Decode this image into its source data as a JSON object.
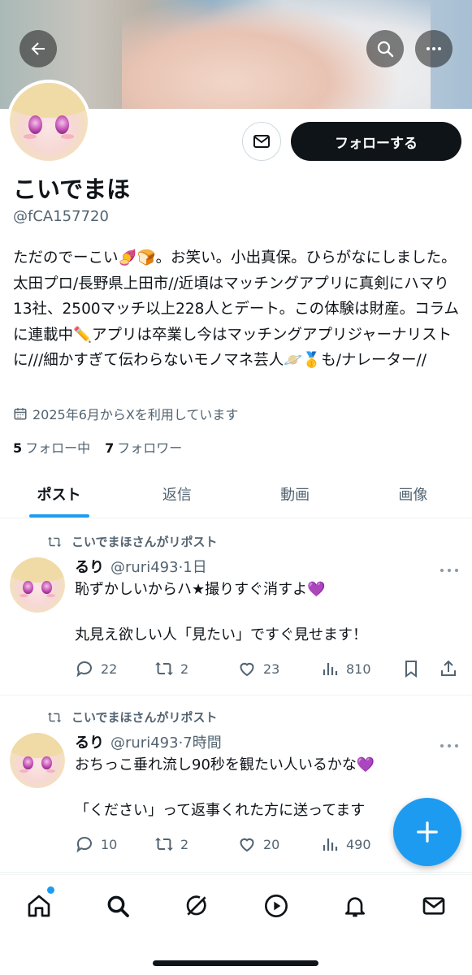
{
  "profile": {
    "name": "こいでまほ",
    "handle": "@fCA157720",
    "bio": "ただのでーこい🍠🍞。お笑い。小出真保。ひらがなにしました。太田プロ/長野県上田市//近頃はマッチングアプリに真剣にハマり13社、2500マッチ以上228人とデート。この体験は財産。コラムに連載中✏️アプリは卒業し今はマッチングアプリジャーナリストに///細かすぎて伝わらないモノマネ芸人🪐🥇も/ナレーター//",
    "joined": "2025年6月からXを利用しています",
    "following_count": "5",
    "following_label": "フォロー中",
    "followers_count": "7",
    "followers_label": "フォロワー",
    "follow_button": "フォローする"
  },
  "tabs": [
    {
      "label": "ポスト",
      "active": true
    },
    {
      "label": "返信",
      "active": false
    },
    {
      "label": "動画",
      "active": false
    },
    {
      "label": "画像",
      "active": false
    }
  ],
  "posts": [
    {
      "repost_label": "こいでまほさんがリポスト",
      "author": "るり",
      "meta": "@ruri493·1日",
      "text": "恥ずかしいからハ★撮りすぐ消すよ💜\n\n丸見え欲しい人「見たい」ですぐ見せます！",
      "replies": "22",
      "reposts": "2",
      "likes": "23",
      "views": "810"
    },
    {
      "repost_label": "こいでまほさんがリポスト",
      "author": "るり",
      "meta": "@ruri493·7時間",
      "text": "おちっこ垂れ流し90秒を観たい人いるかな💜\n\n「ください」って返事くれた方に送ってます",
      "replies": "10",
      "reposts": "2",
      "likes": "20",
      "views": "490"
    }
  ],
  "colors": {
    "accent": "#1d9bf0",
    "text": "#0f1419",
    "muted": "#536471"
  },
  "icons": [
    "back-arrow-icon",
    "search-icon",
    "more-icon",
    "mail-icon",
    "calendar-icon",
    "repost-icon",
    "reply-icon",
    "like-icon",
    "views-icon",
    "bookmark-icon",
    "share-icon",
    "plus-icon",
    "home-icon",
    "explore-icon",
    "grok-icon",
    "video-icon",
    "bell-icon",
    "messages-icon"
  ]
}
